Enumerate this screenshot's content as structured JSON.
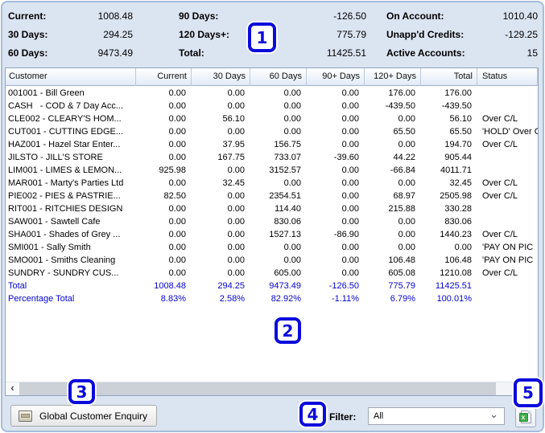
{
  "summary": {
    "col1": [
      {
        "label": "Current:",
        "value": "1008.48"
      },
      {
        "label": "30 Days:",
        "value": "294.25"
      },
      {
        "label": "60 Days:",
        "value": "9473.49"
      }
    ],
    "col2": [
      {
        "label": "90 Days:",
        "value": "-126.50"
      },
      {
        "label": "120 Days+:",
        "value": "775.79"
      },
      {
        "label": "Total:",
        "value": "11425.51"
      }
    ],
    "col3": [
      {
        "label": "On Account:",
        "value": "1010.40"
      },
      {
        "label": "Unapp'd Credits:",
        "value": "-129.25"
      },
      {
        "label": "Active Accounts:",
        "value": "15"
      }
    ]
  },
  "table": {
    "columns": [
      "Customer",
      "Current",
      "30 Days",
      "60 Days",
      "90+ Days",
      "120+ Days",
      "Total",
      "Status"
    ],
    "rows": [
      [
        "001001 - Bill Green",
        "0.00",
        "0.00",
        "0.00",
        "0.00",
        "176.00",
        "176.00",
        ""
      ],
      [
        "CASH   - COD & 7 Day Acc...",
        "0.00",
        "0.00",
        "0.00",
        "0.00",
        "-439.50",
        "-439.50",
        ""
      ],
      [
        "CLE002 - CLEARY'S HOM...",
        "0.00",
        "56.10",
        "0.00",
        "0.00",
        "0.00",
        "56.10",
        "Over C/L"
      ],
      [
        "CUT001 - CUTTING EDGE...",
        "0.00",
        "0.00",
        "0.00",
        "0.00",
        "65.50",
        "65.50",
        "'HOLD' Over C/L"
      ],
      [
        "HAZ001 - Hazel Star Enter...",
        "0.00",
        "37.95",
        "156.75",
        "0.00",
        "0.00",
        "194.70",
        "Over C/L"
      ],
      [
        "JILSTO - JILL'S STORE",
        "0.00",
        "167.75",
        "733.07",
        "-39.60",
        "44.22",
        "905.44",
        ""
      ],
      [
        "LIM001 - LIMES & LEMON...",
        "925.98",
        "0.00",
        "3152.57",
        "0.00",
        "-66.84",
        "4011.71",
        ""
      ],
      [
        "MAR001 - Marty's Parties Ltd",
        "0.00",
        "32.45",
        "0.00",
        "0.00",
        "0.00",
        "32.45",
        "Over C/L"
      ],
      [
        "PIE002 - PIES & PASTRIE...",
        "82.50",
        "0.00",
        "2354.51",
        "0.00",
        "68.97",
        "2505.98",
        "Over C/L"
      ],
      [
        "RIT001 - RITCHIES DESIGN",
        "0.00",
        "0.00",
        "114.40",
        "0.00",
        "215.88",
        "330.28",
        ""
      ],
      [
        "SAW001 - Sawtell Cafe",
        "0.00",
        "0.00",
        "830.06",
        "0.00",
        "0.00",
        "830.06",
        ""
      ],
      [
        "SHA001 - Shades of Grey ...",
        "0.00",
        "0.00",
        "1527.13",
        "-86.90",
        "0.00",
        "1440.23",
        "Over C/L"
      ],
      [
        "SMI001 - Sally Smith",
        "0.00",
        "0.00",
        "0.00",
        "0.00",
        "0.00",
        "0.00",
        "'PAY ON PIC"
      ],
      [
        "SMO001 - Smiths Cleaning",
        "0.00",
        "0.00",
        "0.00",
        "0.00",
        "106.48",
        "106.48",
        "'PAY ON PIC"
      ],
      [
        "SUNDRY - SUNDRY CUS...",
        "0.00",
        "0.00",
        "605.00",
        "0.00",
        "605.08",
        "1210.08",
        "Over C/L"
      ]
    ],
    "total_row": [
      "Total",
      "1008.48",
      "294.25",
      "9473.49",
      "-126.50",
      "775.79",
      "11425.51",
      ""
    ],
    "percentage_row": [
      "Percentage Total",
      "8.83%",
      "2.58%",
      "82.92%",
      "-1.11%",
      "6.79%",
      "100.01%",
      ""
    ]
  },
  "scrollbar": {
    "left_arrow": "‹"
  },
  "footer": {
    "enquiry_button_label": "Global Customer Enquiry",
    "filter_label": "Filter:",
    "filter_value": "All",
    "chevron": "⌄",
    "excel_glyph": "x"
  },
  "callouts": {
    "n1": "1",
    "n2": "2",
    "n3": "3",
    "n4": "4",
    "n5": "5"
  },
  "colors": {
    "callout_blue": "#0b0bdc",
    "totals_blue": "#0404cc",
    "panel_border": "#a6bcdb",
    "panel_bg": "#dbe4f1"
  }
}
